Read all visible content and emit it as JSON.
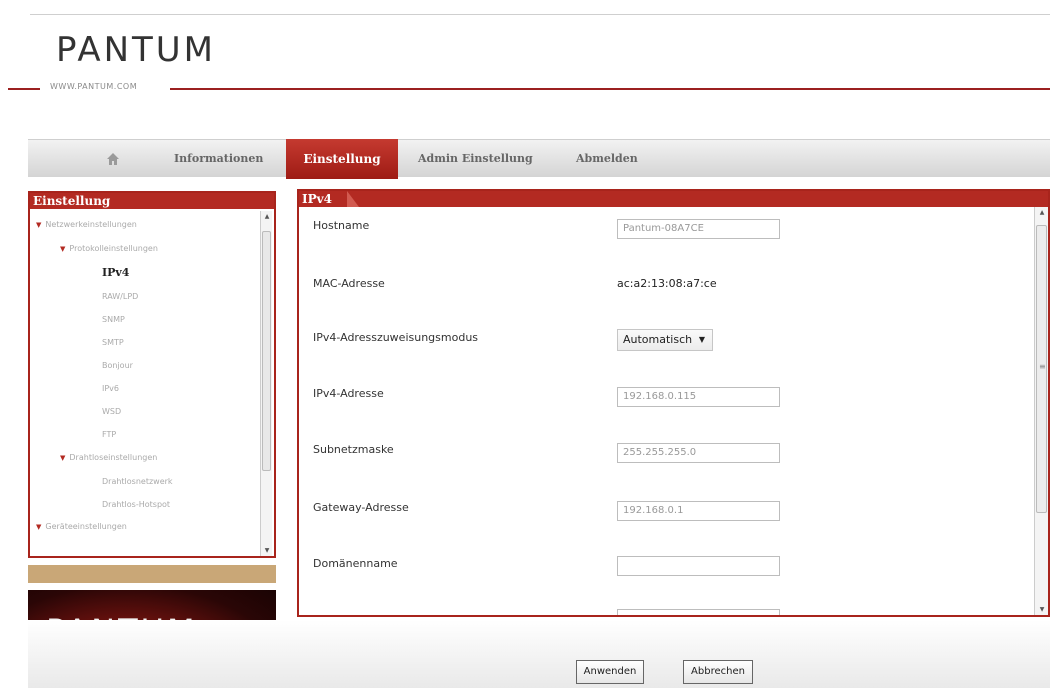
{
  "header": {
    "logo": "PANTUM",
    "url": "WWW.PANTUM.COM"
  },
  "nav": {
    "items": [
      {
        "label": "Informationen"
      },
      {
        "label": "Einstellung"
      },
      {
        "label": "Admin Einstellung"
      },
      {
        "label": "Abmelden"
      }
    ],
    "active": "Einstellung",
    "home_icon": "home-icon"
  },
  "sidebar": {
    "title": "Einstellung",
    "tree": [
      {
        "label": "Netzwerkeinstellungen",
        "level": 0,
        "expanded": true
      },
      {
        "label": "Protokolleinstellungen",
        "level": 1,
        "expanded": true
      },
      {
        "label": "IPv4",
        "level": 2,
        "selected": true
      },
      {
        "label": "RAW/LPD",
        "level": 2
      },
      {
        "label": "SNMP",
        "level": 2
      },
      {
        "label": "SMTP",
        "level": 2
      },
      {
        "label": "Bonjour",
        "level": 2
      },
      {
        "label": "IPv6",
        "level": 2
      },
      {
        "label": "WSD",
        "level": 2
      },
      {
        "label": "FTP",
        "level": 2
      },
      {
        "label": "Drahtloseinstellungen",
        "level": 1,
        "expanded": true
      },
      {
        "label": "Drahtlosnetzwerk",
        "level": 2
      },
      {
        "label": "Drahtlos-Hotspot",
        "level": 2
      },
      {
        "label": "Geräteeinstellungen",
        "level": 0,
        "expanded": true
      }
    ],
    "promo_logo": "PANTUM"
  },
  "main": {
    "title": "IPv4",
    "fields": [
      {
        "label": "Hostname",
        "value": "Pantum-08A7CE",
        "kind": "input"
      },
      {
        "label": "MAC-Adresse",
        "value": "ac:a2:13:08:a7:ce",
        "kind": "text"
      },
      {
        "label": "IPv4-Adresszuweisungsmodus",
        "value": "Automatisch",
        "kind": "select"
      },
      {
        "label": "IPv4-Adresse",
        "value": "192.168.0.115",
        "kind": "input"
      },
      {
        "label": "Subnetzmaske",
        "value": "255.255.255.0",
        "kind": "input"
      },
      {
        "label": "Gateway-Adresse",
        "value": "192.168.0.1",
        "kind": "input"
      },
      {
        "label": "Domänenname",
        "value": "",
        "kind": "input"
      }
    ]
  },
  "buttons": {
    "apply": "Anwenden",
    "cancel": "Abbrechen"
  },
  "colors": {
    "accent": "#b32a22",
    "gold": "#c9a777"
  }
}
